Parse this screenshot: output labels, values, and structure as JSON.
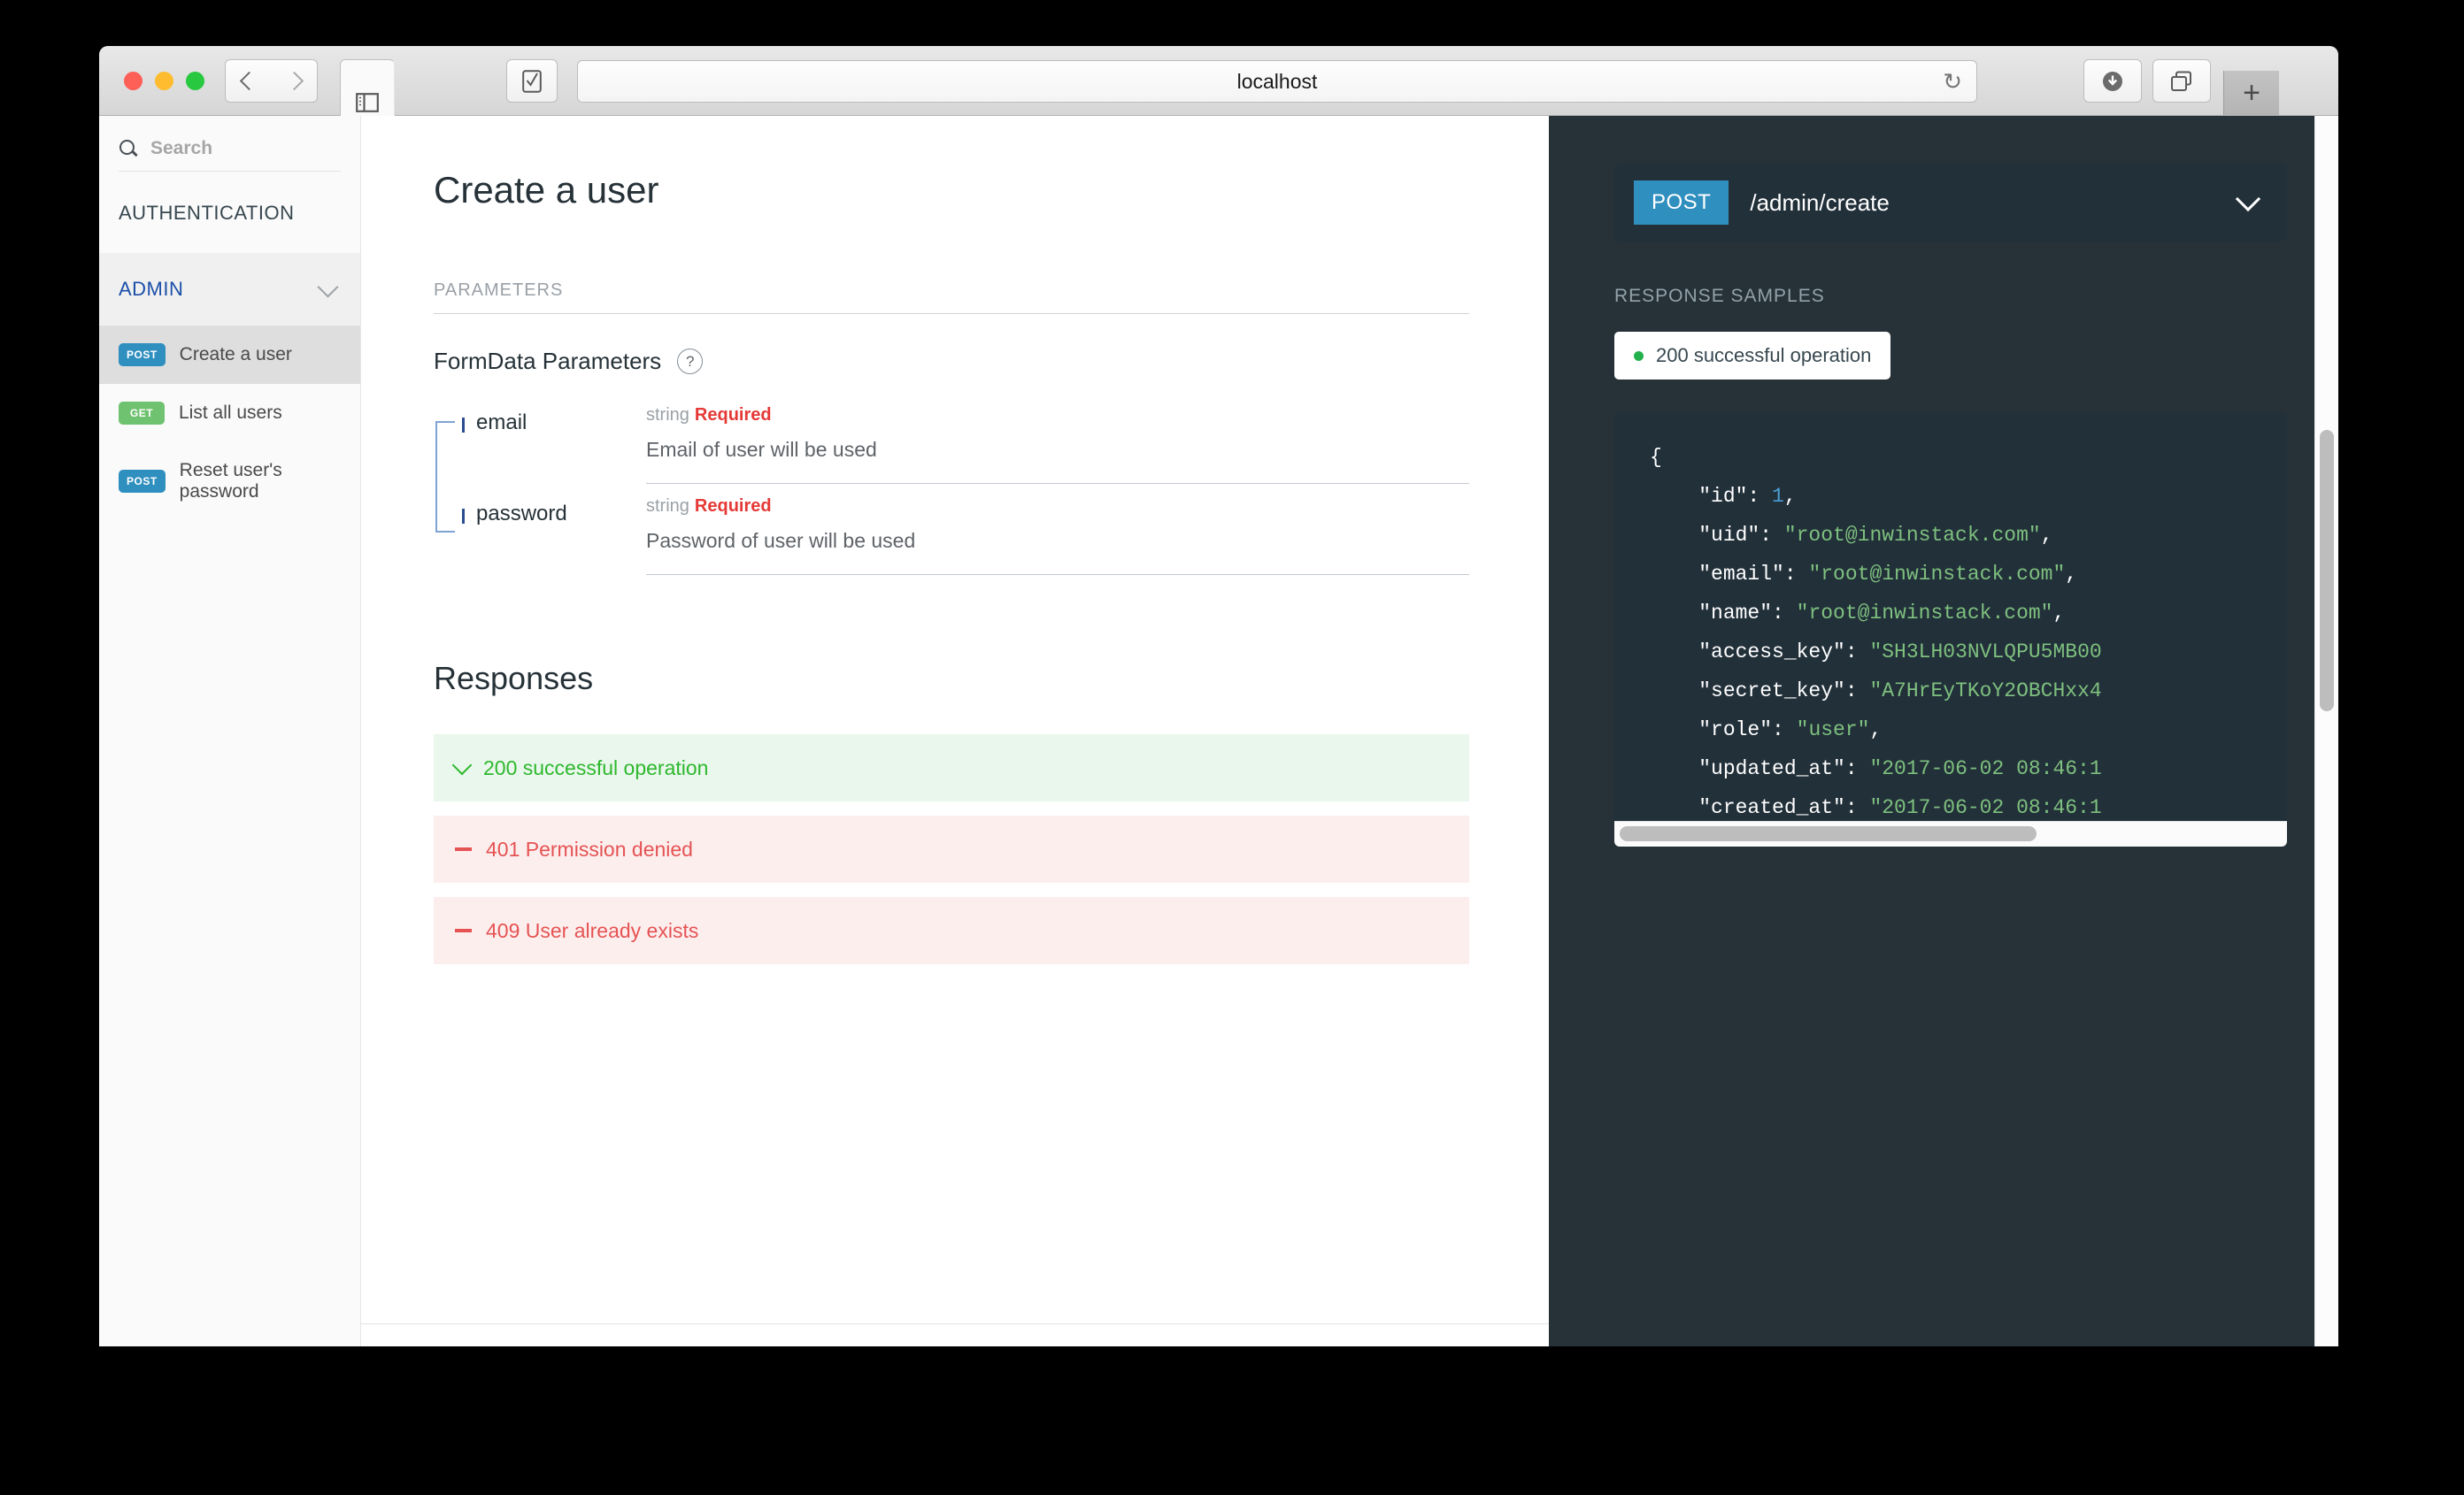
{
  "browser": {
    "url": "localhost",
    "reload_icon": "reload-icon",
    "back_icon": "chevron-left-icon",
    "forward_icon": "chevron-right-icon",
    "sidebar_icon": "sidebar-toggle-icon",
    "reader_icon": "reader-view-icon",
    "download_icon": "download-icon",
    "tabs_icon": "tab-overview-icon",
    "newtab_label": "+"
  },
  "sidebar": {
    "search": {
      "placeholder": "Search",
      "icon": "search-icon"
    },
    "groups": [
      {
        "label": "AUTHENTICATION",
        "expanded": false,
        "items": []
      },
      {
        "label": "ADMIN",
        "expanded": true,
        "caret_icon": "chevron-down-icon",
        "items": [
          {
            "verb": "POST",
            "label": "Create a user",
            "active": true
          },
          {
            "verb": "GET",
            "label": "List all users",
            "active": false
          },
          {
            "verb": "POST",
            "label": "Reset user's password",
            "active": false
          }
        ]
      }
    ]
  },
  "main": {
    "title": "Create a user",
    "parameters_label": "PARAMETERS",
    "formdata_label": "FormData Parameters",
    "help_icon": "help-icon",
    "parameters": [
      {
        "name": "email",
        "type": "string",
        "required_label": "Required",
        "description": "Email of user will be used"
      },
      {
        "name": "password",
        "type": "string",
        "required_label": "Required",
        "description": "Password of user will be used"
      }
    ],
    "responses_title": "Responses",
    "responses": [
      {
        "code": "200",
        "text": "200 successful operation",
        "status": "ok",
        "icon": "chevron-down-icon"
      },
      {
        "code": "401",
        "text": "401 Permission denied",
        "status": "err",
        "icon": "dash-icon"
      },
      {
        "code": "409",
        "text": "409 User already exists",
        "status": "err",
        "icon": "dash-icon"
      }
    ]
  },
  "rightpanel": {
    "endpoint": {
      "verb": "POST",
      "path": "/admin/create",
      "caret_icon": "chevron-down-icon"
    },
    "samples_label": "RESPONSE SAMPLES",
    "sample_tab": "200 successful operation",
    "code_lines": [
      {
        "parts": [
          {
            "t": "{",
            "c": "plain"
          }
        ]
      },
      {
        "parts": [
          {
            "t": "    \"id\": ",
            "c": "plain"
          },
          {
            "t": "1",
            "c": "num"
          },
          {
            "t": ",",
            "c": "plain"
          }
        ]
      },
      {
        "parts": [
          {
            "t": "    \"uid\": ",
            "c": "plain"
          },
          {
            "t": "\"root@inwinstack.com\"",
            "c": "str"
          },
          {
            "t": ",",
            "c": "plain"
          }
        ]
      },
      {
        "parts": [
          {
            "t": "    \"email\": ",
            "c": "plain"
          },
          {
            "t": "\"root@inwinstack.com\"",
            "c": "str"
          },
          {
            "t": ",",
            "c": "plain"
          }
        ]
      },
      {
        "parts": [
          {
            "t": "    \"name\": ",
            "c": "plain"
          },
          {
            "t": "\"root@inwinstack.com\"",
            "c": "str"
          },
          {
            "t": ",",
            "c": "plain"
          }
        ]
      },
      {
        "parts": [
          {
            "t": "    \"access_key\": ",
            "c": "plain"
          },
          {
            "t": "\"SH3LH03NVLQPU5MB00",
            "c": "str"
          }
        ]
      },
      {
        "parts": [
          {
            "t": "    \"secret_key\": ",
            "c": "plain"
          },
          {
            "t": "\"A7HrEyTKoY2OBCHxx4",
            "c": "str"
          }
        ]
      },
      {
        "parts": [
          {
            "t": "    \"role\": ",
            "c": "plain"
          },
          {
            "t": "\"user\"",
            "c": "str"
          },
          {
            "t": ",",
            "c": "plain"
          }
        ]
      },
      {
        "parts": [
          {
            "t": "    \"updated_at\": ",
            "c": "plain"
          },
          {
            "t": "\"2017-06-02 08:46:1",
            "c": "str"
          }
        ]
      },
      {
        "parts": [
          {
            "t": "    \"created_at\": ",
            "c": "plain"
          },
          {
            "t": "\"2017-06-02 08:46:1",
            "c": "str"
          }
        ]
      },
      {
        "parts": [
          {
            "t": "}",
            "c": "plain"
          }
        ]
      }
    ]
  },
  "colors": {
    "post_badge": "#2f8fbf",
    "get_badge": "#6fc26f",
    "panel_bg": "#263238",
    "code_bg": "#22303a",
    "success": "#2eb82e",
    "error": "#e55353",
    "admin_link": "#1b4fa8",
    "code_string": "#7ec07e",
    "code_number": "#4a9fd4"
  }
}
